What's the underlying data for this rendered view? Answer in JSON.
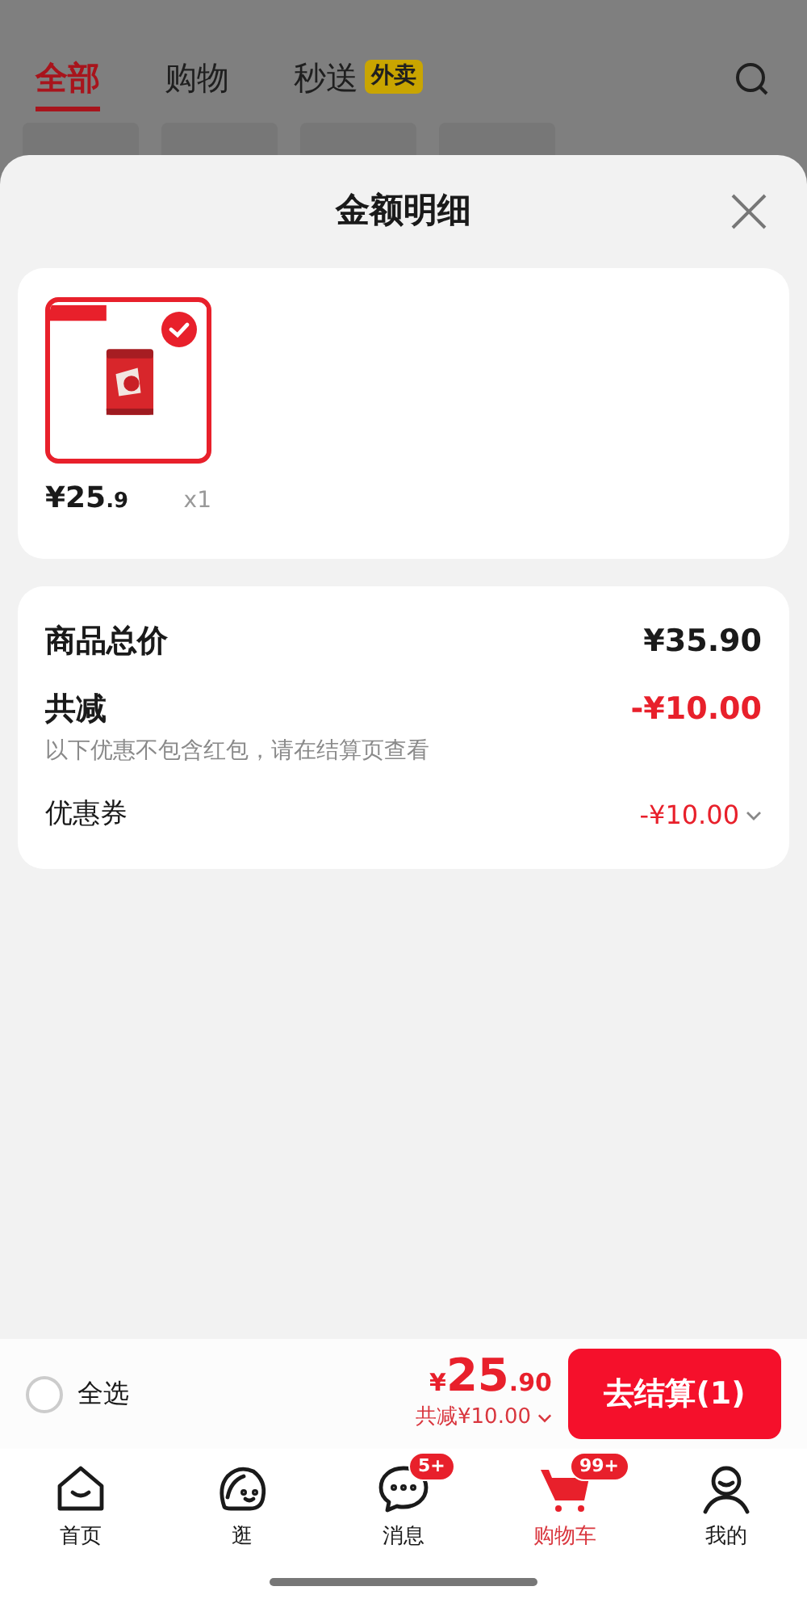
{
  "background": {
    "tabs": [
      {
        "label": "全部",
        "selected": true
      },
      {
        "label": "购物",
        "selected": false
      },
      {
        "label": "秒送",
        "selected": false,
        "badge": "外卖"
      }
    ]
  },
  "sheet": {
    "title": "金额明细",
    "items": [
      {
        "kind": "picture",
        "selected": true,
        "price_main": "¥25",
        "price_fraction": ".9",
        "quantity": "x1"
      }
    ],
    "summary": {
      "total_label": "商品总价",
      "total_value": "¥35.90",
      "discount_label": "共减",
      "discount_value": "-¥10.00",
      "note": "以下优惠不包含红包，请在结算页查看",
      "coupon_label": "优惠券",
      "coupon_value": "-¥10.00"
    }
  },
  "checkout_bar": {
    "select_all": {
      "label": "全选",
      "checked": false
    },
    "currency": "¥",
    "price_main": "25",
    "price_fraction": ".90",
    "discount": "共减¥10.00",
    "button": "去结算(1)"
  },
  "nav": [
    {
      "label": "首页",
      "selected": false,
      "kind": "home"
    },
    {
      "label": "逛",
      "selected": false,
      "kind": "browse"
    },
    {
      "label": "消息",
      "selected": false,
      "kind": "message",
      "badge": "5+"
    },
    {
      "label": "购物车",
      "selected": true,
      "kind": "cart",
      "badge": "99+"
    },
    {
      "label": "我的",
      "selected": false,
      "kind": "me"
    }
  ]
}
